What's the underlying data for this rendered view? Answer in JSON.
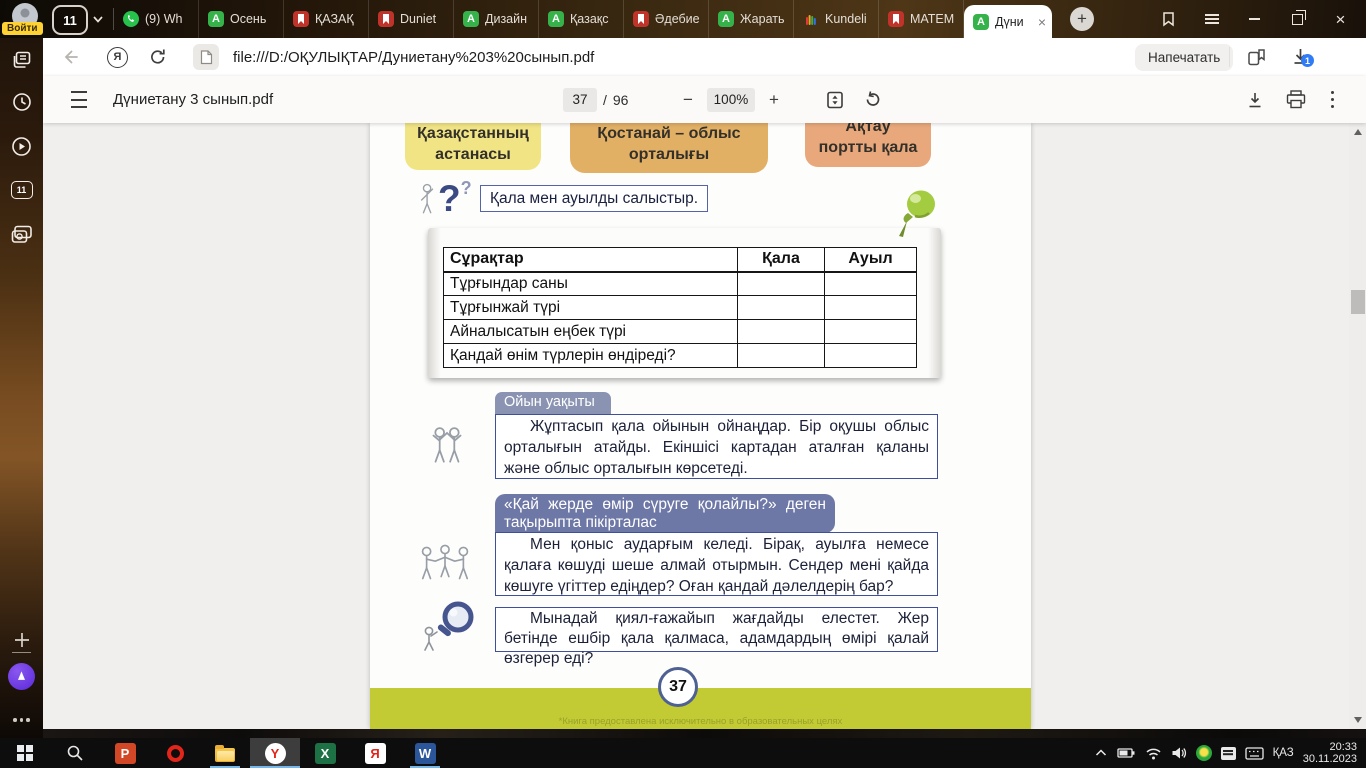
{
  "icon_glyphs": {
    "green_a": "A",
    "plus": "+",
    "minus": "−",
    "close": "×",
    "question_mark": "?",
    "powerpoint": "P",
    "excel": "X",
    "word": "W",
    "yandex_y": "Y",
    "yandex_ya": "Я"
  },
  "browser": {
    "login_label": "Войти",
    "tab_counter": "11",
    "tabs": [
      {
        "label": "(9) Wh",
        "icon": "whatsapp"
      },
      {
        "label": "Осень",
        "icon": "green-a"
      },
      {
        "label": "ҚАЗАҚ",
        "icon": "red-textbook"
      },
      {
        "label": "Duniet",
        "icon": "red-textbook"
      },
      {
        "label": "Дизайн",
        "icon": "green-a"
      },
      {
        "label": "Қазақс",
        "icon": "green-a"
      },
      {
        "label": "Әдебие",
        "icon": "red-textbook"
      },
      {
        "label": "Жарать",
        "icon": "green-a"
      },
      {
        "label": "Kundeli",
        "icon": "kundelik-hand"
      },
      {
        "label": "МАТЕМ",
        "icon": "red-textbook"
      },
      {
        "label": "Дүни",
        "icon": "green-a",
        "active": true
      }
    ],
    "address": {
      "url": "file:///D:/ОҚУЛЫҚТАР/Дуниетану%203%20сынып.pdf",
      "print_button": "Напечатать",
      "download_badge": "1"
    }
  },
  "pdf": {
    "toolbar": {
      "title": "Дүниетану 3 сынып.pdf",
      "page_current": "37",
      "page_separator": "/",
      "page_total": "96",
      "zoom": "100%"
    },
    "page": {
      "header_boxes": [
        {
          "line1": "Қазақстанның",
          "line2": "астанасы",
          "color": "#f1e485"
        },
        {
          "line1": "Қостанай – облыс",
          "line2": "орталығы",
          "color": "#e2b065"
        },
        {
          "line1": "Ақтау",
          "line2": "портты қала",
          "color": "#e9a87c"
        }
      ],
      "task_prompt": "Қала мен ауылды салыстыр.",
      "table": {
        "headers": [
          "Сұрақтар",
          "Қала",
          "Ауыл"
        ],
        "rows": [
          "Тұрғындар саны",
          "Тұрғынжай түрі",
          "Айналысатын еңбек түрі",
          "Қандай өнім түрлерін өндіреді?"
        ]
      },
      "game_tab": "Ойын уақыты",
      "game_text": "Жұптасып қала ойынын ойнаңдар. Бір оқушы облыс орталығын атайды. Екіншісі картадан аталған қаланы және облыс орталығын көрсетеді.",
      "debate_tab": "«Қай жерде өмір сүруге қолайлы?» деген тақырыпта пікірталас",
      "debate_text": "Мен қоныс аударғым келеді. Бірақ, ауылға немесе қалаға көшуді шеше алмай отырмын. Сендер мені қайда көшуге үгіттер едіңдер? Оған қандай дәлелдерің бар?",
      "imagine_text": "Мынадай қиял-ғажайып жағдайды елестет. Жер бетінде ешбір қала қалмаса, адамдардың өмірі қалай өзгерер еді?",
      "page_number": "37",
      "footer_note": "*Книга предоставлена исключительно в образовательных целях"
    }
  },
  "taskbar": {
    "language": "ҚАЗ",
    "time": "20:33",
    "date": "30.11.2023"
  }
}
